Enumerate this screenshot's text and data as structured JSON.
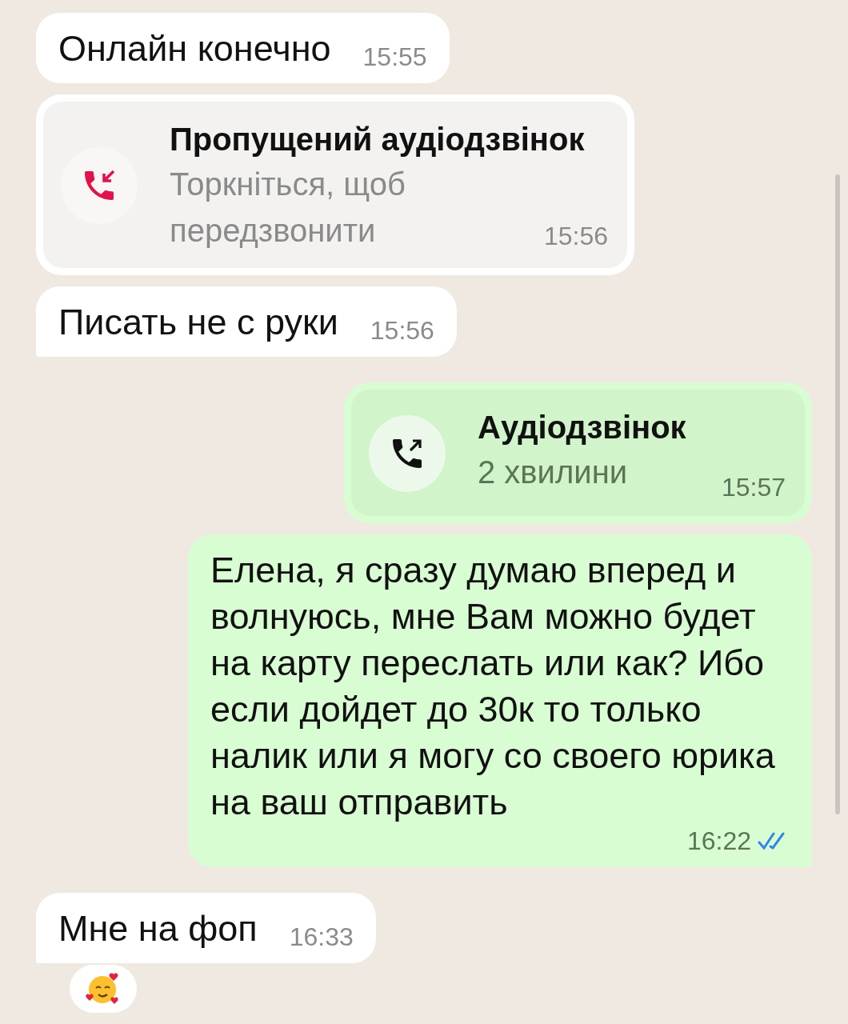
{
  "messages": [
    {
      "kind": "text",
      "outgoing": false,
      "text": "Онлайн конечно",
      "time": "15:55",
      "tail": false
    },
    {
      "kind": "missed_call",
      "outgoing": false,
      "title": "Пропущений аудіодзвінок",
      "subtitle": "Торкніться, щоб передзвонити",
      "time": "15:56"
    },
    {
      "kind": "text",
      "outgoing": false,
      "text": "Писать не с руки",
      "time": "15:56",
      "tail": true
    },
    {
      "kind": "outgoing_call",
      "outgoing": true,
      "title": "Аудіодзвінок",
      "subtitle": "2 хвилини",
      "time": "15:57"
    },
    {
      "kind": "text",
      "outgoing": true,
      "text": "Елена, я сразу думаю вперед и волнуюсь, мне Вам можно будет на карту переслать или как? Ибо если дойдет до 30к то только налик или я могу со своего юрика на ваш отправить",
      "time": "16:22",
      "read": true,
      "tail": true
    },
    {
      "kind": "text",
      "outgoing": false,
      "text": "Мне на фоп",
      "time": "16:33",
      "tail": true,
      "reacted": true
    }
  ]
}
